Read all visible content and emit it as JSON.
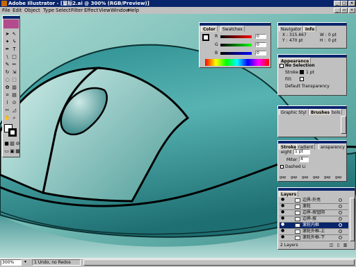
{
  "window": {
    "title": "Adobe Illustrator - [鼠标2.ai @ 300% (RGB/Preview)]"
  },
  "menu": [
    "File",
    "Edit",
    "Object",
    "Type",
    "Select",
    "Filter",
    "Effect",
    "View",
    "Window",
    "Help"
  ],
  "color_panel": {
    "tabs": [
      "Color",
      "Swatches"
    ],
    "channels": [
      {
        "label": "R",
        "value": "0"
      },
      {
        "label": "G",
        "value": "0"
      },
      {
        "label": "B",
        "value": "0"
      }
    ]
  },
  "navigator_panel": {
    "tabs": [
      "Navigator",
      "Info"
    ],
    "x_label": "X :",
    "x_value": "315.667",
    "y_label": "Y :",
    "y_value": "470 pt",
    "w_label": "W :",
    "w_value": "0 pt",
    "h_label": "H :",
    "h_value": "0 pt"
  },
  "appearance_panel": {
    "title": "Appearance",
    "no_selection": "No Selection",
    "stroke_label": "Stroke",
    "stroke_value": "1 pt",
    "fill_label": "Fill:",
    "default_transparency": "Default Transparency"
  },
  "graphic_styles_panel": {
    "tabs": [
      "Graphic Styl",
      "Brushes",
      "bols"
    ]
  },
  "stroke_panel": {
    "tabs": [
      "Stroke",
      "radient",
      "ansparency"
    ],
    "weight_label": "eight",
    "weight_value": "1 pt",
    "miter_label": "Miter",
    "miter_value": "4",
    "dashed_label": "Dashed Li",
    "dash_labels": [
      "gap",
      "gap",
      "gap",
      "gap",
      "gap",
      "gap"
    ]
  },
  "layers_panel": {
    "title": "Layers",
    "layers": [
      "边界-外亮",
      "滚轮",
      "边界-按钮阴",
      "边界-按",
      "滚轮内框",
      "滚轮外框-上",
      "滚轮外框-下"
    ],
    "selected_index": 4,
    "footer": "2 Layers"
  },
  "status": {
    "zoom": "300%",
    "message": "1 Undo, no Redos"
  },
  "colors": {
    "title_bar": "#08246b",
    "canvas_teal": "#5aa6a2",
    "mouse_body": "#3fa0a0"
  }
}
